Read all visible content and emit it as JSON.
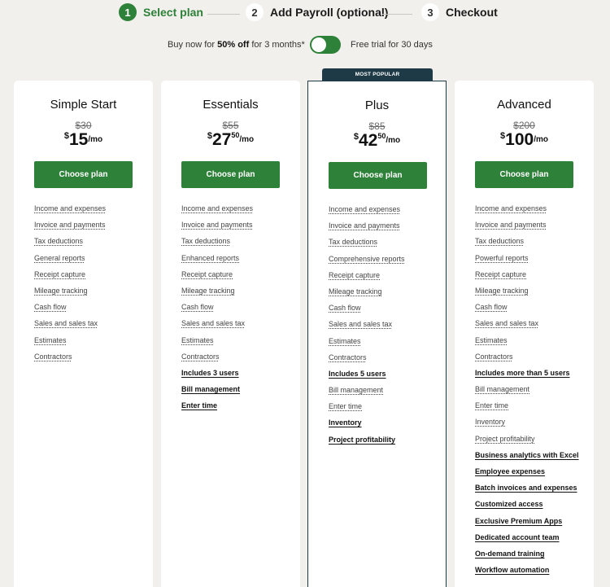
{
  "stepper": [
    {
      "num": "1",
      "label": "Select plan",
      "active": true
    },
    {
      "num": "2",
      "label": "Add Payroll (optional)",
      "active": false
    },
    {
      "num": "3",
      "label": "Checkout",
      "active": false
    }
  ],
  "toggle": {
    "pre": "Buy now for ",
    "bold": "50% off",
    "post": " for 3 months*",
    "trial": "Free trial for 30 days",
    "on": true
  },
  "badge": "MOST POPULAR",
  "button_label": "Choose plan",
  "plans": [
    {
      "name": "Simple Start",
      "old_price": "$30",
      "currency": "$",
      "amount": "15",
      "cents": "",
      "per": "/mo",
      "features": [
        {
          "text": "Income and expenses",
          "bold": false
        },
        {
          "text": "Invoice and payments",
          "bold": false
        },
        {
          "text": "Tax deductions",
          "bold": false
        },
        {
          "text": "General reports",
          "bold": false
        },
        {
          "text": "Receipt capture",
          "bold": false
        },
        {
          "text": "Mileage tracking",
          "bold": false
        },
        {
          "text": "Cash flow",
          "bold": false
        },
        {
          "text": "Sales and sales tax",
          "bold": false
        },
        {
          "text": "Estimates",
          "bold": false
        },
        {
          "text": "Contractors",
          "bold": false
        }
      ]
    },
    {
      "name": "Essentials",
      "old_price": "$55",
      "currency": "$",
      "amount": "27",
      "cents": "50",
      "per": "/mo",
      "features": [
        {
          "text": "Income and expenses",
          "bold": false
        },
        {
          "text": "Invoice and payments",
          "bold": false
        },
        {
          "text": "Tax deductions",
          "bold": false
        },
        {
          "text": "Enhanced reports",
          "bold": false
        },
        {
          "text": "Receipt capture",
          "bold": false
        },
        {
          "text": "Mileage tracking",
          "bold": false
        },
        {
          "text": "Cash flow",
          "bold": false
        },
        {
          "text": "Sales and sales tax",
          "bold": false
        },
        {
          "text": "Estimates",
          "bold": false
        },
        {
          "text": "Contractors",
          "bold": false
        },
        {
          "text": "Includes 3 users",
          "bold": true
        },
        {
          "text": "Bill management",
          "bold": true
        },
        {
          "text": "Enter time",
          "bold": true
        }
      ]
    },
    {
      "name": "Plus",
      "old_price": "$85",
      "currency": "$",
      "amount": "42",
      "cents": "50",
      "per": "/mo",
      "popular": true,
      "features": [
        {
          "text": "Income and expenses",
          "bold": false
        },
        {
          "text": "Invoice and payments",
          "bold": false
        },
        {
          "text": "Tax deductions",
          "bold": false
        },
        {
          "text": "Comprehensive reports",
          "bold": false
        },
        {
          "text": "Receipt capture",
          "bold": false
        },
        {
          "text": "Mileage tracking",
          "bold": false
        },
        {
          "text": "Cash flow",
          "bold": false
        },
        {
          "text": "Sales and sales tax",
          "bold": false
        },
        {
          "text": "Estimates",
          "bold": false
        },
        {
          "text": "Contractors",
          "bold": false
        },
        {
          "text": "Includes 5 users",
          "bold": true
        },
        {
          "text": "Bill management",
          "bold": false
        },
        {
          "text": "Enter time",
          "bold": false
        },
        {
          "text": "Inventory",
          "bold": true
        },
        {
          "text": "Project profitability",
          "bold": true
        }
      ]
    },
    {
      "name": "Advanced",
      "old_price": "$200",
      "currency": "$",
      "amount": "100",
      "cents": "",
      "per": "/mo",
      "features": [
        {
          "text": "Income and expenses",
          "bold": false
        },
        {
          "text": "Invoice and payments",
          "bold": false
        },
        {
          "text": "Tax deductions",
          "bold": false
        },
        {
          "text": "Powerful reports",
          "bold": false
        },
        {
          "text": "Receipt capture",
          "bold": false
        },
        {
          "text": "Mileage tracking",
          "bold": false
        },
        {
          "text": "Cash flow",
          "bold": false
        },
        {
          "text": "Sales and sales tax",
          "bold": false
        },
        {
          "text": "Estimates",
          "bold": false
        },
        {
          "text": "Contractors",
          "bold": false
        },
        {
          "text": "Includes more than 5 users",
          "bold": true
        },
        {
          "text": "Bill management",
          "bold": false
        },
        {
          "text": "Enter time",
          "bold": false
        },
        {
          "text": "Inventory",
          "bold": false
        },
        {
          "text": "Project profitability",
          "bold": false
        },
        {
          "text": "Business analytics with Excel",
          "bold": true
        },
        {
          "text": "Employee expenses",
          "bold": true
        },
        {
          "text": "Batch invoices and expenses",
          "bold": true
        },
        {
          "text": "Customized access",
          "bold": true
        },
        {
          "text": "Exclusive Premium Apps",
          "bold": true
        },
        {
          "text": "Dedicated account team",
          "bold": true
        },
        {
          "text": "On-demand training",
          "bold": true
        },
        {
          "text": "Workflow automation",
          "bold": true
        }
      ]
    }
  ]
}
